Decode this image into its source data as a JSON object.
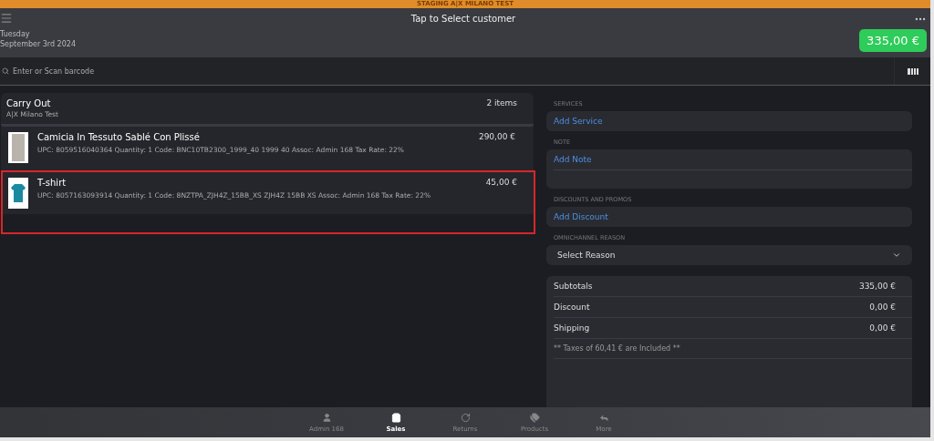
{
  "banner": "STAGING A|X MILANO TEST",
  "header": {
    "title": "Tap to Select customer",
    "day": "Tuesday",
    "date": "September 3rd 2024",
    "total": "335,00 €"
  },
  "search": {
    "placeholder": "Enter or Scan barcode"
  },
  "cart": {
    "title": "Carry Out",
    "store": "A|X Milano Test",
    "count": "2 items",
    "items": [
      {
        "kind": "photo",
        "name": "Camicia In Tessuto Sablé Con Plissé",
        "details": "UPC: 8059516040364 Quantity: 1 Code: BNC10TB2300_1999_40 1999 40 Assoc: Admin 168 Tax Rate: 22%",
        "price": "290,00 €",
        "selected": false
      },
      {
        "kind": "tshirt",
        "name": "T-shirt",
        "details": "UPC: 8057163093914 Quantity: 1 Code: 8NZTPA_ZJH4Z_15BB_XS ZJH4Z 15BB XS Assoc: Admin 168 Tax Rate: 22%",
        "price": "45,00 €",
        "selected": true
      }
    ]
  },
  "sections": [
    {
      "label": "SERVICES",
      "kind": "link",
      "text": "Add Service"
    },
    {
      "label": "NOTE",
      "kind": "note",
      "placeholder": "Add Note"
    },
    {
      "label": "DISCOUNTS AND PROMOS",
      "kind": "link",
      "text": "Add Discount"
    },
    {
      "label": "OMNICHANNEL REASON",
      "kind": "select",
      "text": "Select Reason"
    }
  ],
  "totals": [
    {
      "label": "Subtotals",
      "value": "335,00 €"
    },
    {
      "label": "Discount",
      "value": "0,00 €"
    },
    {
      "label": "Shipping",
      "value": "0,00 €"
    }
  ],
  "taxes_note": "** Taxes of 60,41 € are Included **",
  "tabs": [
    {
      "kind": "user",
      "label": "Admin 168",
      "selected": false
    },
    {
      "kind": "bag",
      "label": "Sales",
      "selected": true
    },
    {
      "kind": "returns",
      "label": "Returns",
      "selected": false
    },
    {
      "kind": "tags",
      "label": "Products",
      "selected": false
    },
    {
      "kind": "more",
      "label": "More",
      "selected": false
    }
  ]
}
